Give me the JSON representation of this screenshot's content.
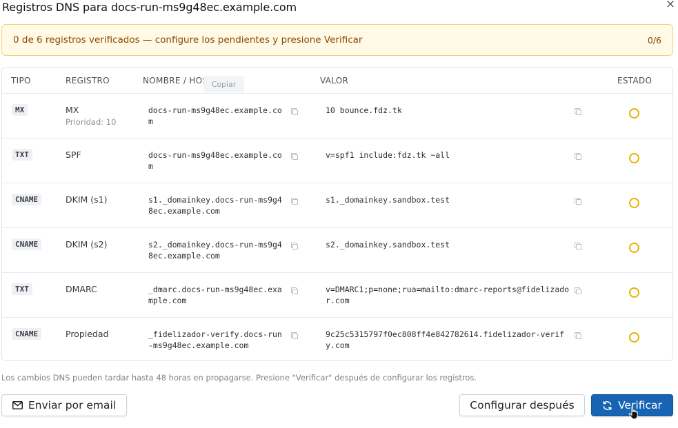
{
  "dialog": {
    "title": "Registros DNS para docs-run-ms9g48ec.example.com",
    "close_glyph": "×"
  },
  "banner": {
    "text": "0 de 6 registros verificados — configure los pendientes y presione Verificar",
    "count": "0/6",
    "color": "#8a4a00"
  },
  "table": {
    "headers": {
      "type": "TIPO",
      "record": "REGISTRO",
      "host": "NOMBRE / HOST",
      "value": "VALOR",
      "status": "ESTADO"
    },
    "tooltip": "Copiar",
    "rows": [
      {
        "type": "MX",
        "record": "MX",
        "sub": "Prioridad: 10",
        "host": "docs-run-ms9g48ec.example.com",
        "value": "10 bounce.fdz.tk"
      },
      {
        "type": "TXT",
        "record": "SPF",
        "sub": "",
        "host": "docs-run-ms9g48ec.example.com",
        "value": "v=spf1 include:fdz.tk ~all"
      },
      {
        "type": "CNAME",
        "record": "DKIM (s1)",
        "sub": "",
        "host": "s1._domainkey.docs-run-ms9g48ec.example.com",
        "value": "s1._domainkey.sandbox.test"
      },
      {
        "type": "CNAME",
        "record": "DKIM (s2)",
        "sub": "",
        "host": "s2._domainkey.docs-run-ms9g48ec.example.com",
        "value": "s2._domainkey.sandbox.test"
      },
      {
        "type": "TXT",
        "record": "DMARC",
        "sub": "",
        "host": "_dmarc.docs-run-ms9g48ec.example.com",
        "value": "v=DMARC1;p=none;rua=mailto:dmarc-reports@fidelizador.com"
      },
      {
        "type": "CNAME",
        "record": "Propiedad",
        "sub": "",
        "host": "_fidelizador-verify.docs-run-ms9g48ec.example.com",
        "value": "9c25c5315797f0ec808ff4e842782614.fidelizador-verify.com"
      }
    ],
    "status_color": "#e5b300"
  },
  "footnote": "Los cambios DNS pueden tardar hasta 48 horas en propagarse. Presione \"Verificar\" después de configurar los registros.",
  "buttons": {
    "email": "Enviar por email",
    "later": "Configurar después",
    "verify": "Verificar",
    "verify_color": "#1764b3"
  },
  "icons": {
    "close": "close-icon",
    "copy": "copy-icon",
    "mail": "mail-icon",
    "refresh": "refresh-icon",
    "status": "pending-status-icon"
  }
}
